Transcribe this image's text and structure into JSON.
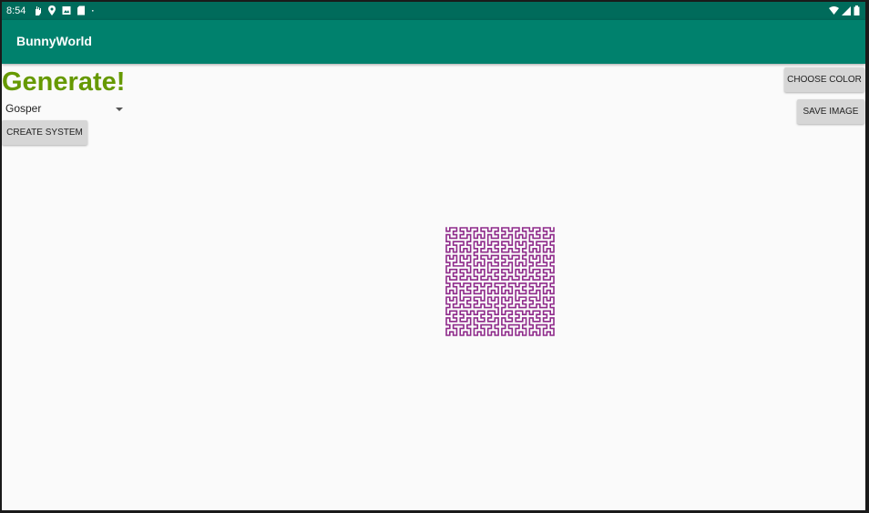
{
  "status_bar": {
    "time": "8:54",
    "icons": [
      "hand-icon",
      "location-icon",
      "image-icon",
      "sd-card-icon",
      "dot-icon"
    ],
    "right_icons": [
      "wifi-icon",
      "signal-icon",
      "battery-icon"
    ]
  },
  "app_bar": {
    "title": "BunnyWorld"
  },
  "main": {
    "heading": "Generate!",
    "spinner": {
      "selected": "Gosper"
    },
    "create_button": "CREATE SYSTEM",
    "choose_color_button": "CHOOSE COLOR",
    "save_image_button": "SAVE IMAGE"
  },
  "drawing": {
    "stroke_color": "#8e2a8a",
    "curve": "Gosper"
  },
  "colors": {
    "status_bar": "#006b5b",
    "app_bar": "#00816d",
    "heading": "#669900",
    "background": "#fafafa"
  }
}
